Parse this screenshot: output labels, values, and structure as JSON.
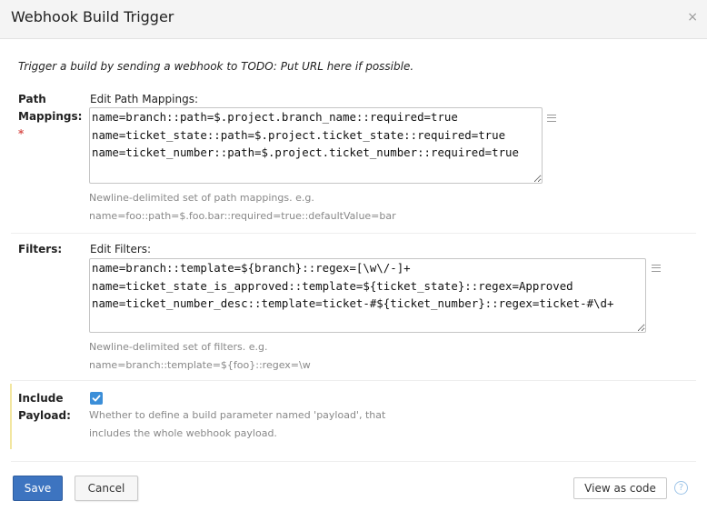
{
  "dialog": {
    "title": "Webhook Build Trigger",
    "close_glyph": "×"
  },
  "description": "Trigger a build by sending a webhook to TODO: Put URL here if possible.",
  "path_mappings": {
    "label_line1": "Path",
    "label_line2": "Mappings:",
    "required_marker": "*",
    "field_label": "Edit Path Mappings:",
    "value": "name=branch::path=$.project.branch_name::required=true\nname=ticket_state::path=$.project.ticket_state::required=true\nname=ticket_number::path=$.project.ticket_number::required=true",
    "hint_line1": "Newline-delimited set of path mappings. e.g.",
    "hint_line2": "name=foo::path=$.foo.bar::required=true::defaultValue=bar",
    "icon": "expand-editor-icon"
  },
  "filters": {
    "label": "Filters:",
    "field_label": "Edit Filters:",
    "value": "name=branch::template=${branch}::regex=[\\w\\/-]+\nname=ticket_state_is_approved::template=${ticket_state}::regex=Approved\nname=ticket_number_desc::template=ticket-#${ticket_number}::regex=ticket-#\\d+",
    "hint_line1": "Newline-delimited set of filters. e.g.",
    "hint_line2": "name=branch::template=${foo}::regex=\\w",
    "icon": "expand-editor-icon"
  },
  "include_payload": {
    "label_line1": "Include",
    "label_line2": "Payload:",
    "checked": true,
    "hint_line1": "Whether to define a build parameter named 'payload', that",
    "hint_line2": "includes the whole webhook payload."
  },
  "buttons": {
    "save": "Save",
    "cancel": "Cancel",
    "view_as_code": "View as code",
    "help_glyph": "?"
  },
  "colors": {
    "primary": "#3d74c0",
    "checkbox": "#3b8ed8",
    "required": "#d9534f",
    "highlight": "#f2e6a0"
  }
}
